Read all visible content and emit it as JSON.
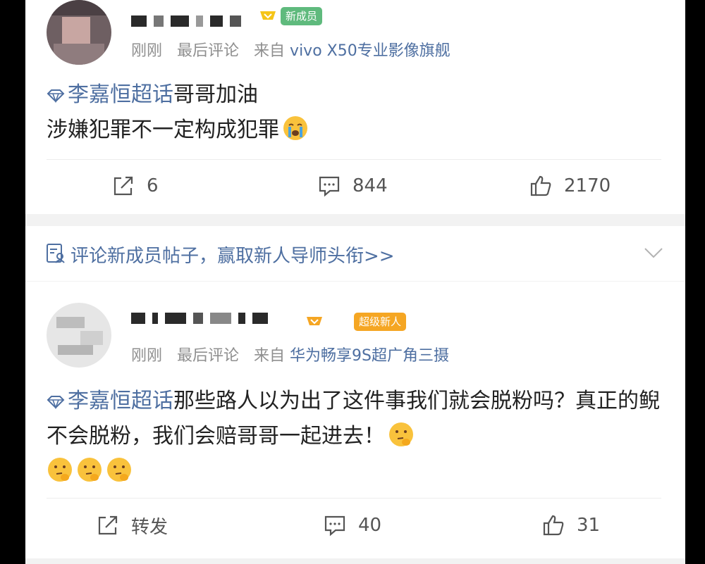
{
  "posts": [
    {
      "badge": "新成员",
      "meta": {
        "time": "刚刚",
        "activity": "最后评论",
        "from_prefix": "来自",
        "device": "vivo X50专业影像旗舰"
      },
      "content": {
        "topic": "李嘉恒超话",
        "line1_text": "哥哥加油",
        "line2_text": "涉嫌犯罪不一定构成犯罪"
      },
      "emojis": [
        "crying-face"
      ],
      "actions": {
        "repost": "6",
        "comments": "844",
        "likes": "2170"
      }
    },
    {
      "badge": "超级新人",
      "meta": {
        "time": "刚刚",
        "activity": "最后评论",
        "from_prefix": "来自",
        "device": "华为畅享9S超广角三摄"
      },
      "content": {
        "topic": "李嘉恒超话",
        "text": "那些路人以为出了这件事我们就会脱粉吗？真正的鲵不会脱粉，我们会赔哥哥一起进去！"
      },
      "emojis": [
        "thinking-face",
        "thinking-face",
        "thinking-face",
        "thinking-face"
      ],
      "actions": {
        "repost": "转发",
        "comments": "40",
        "likes": "31"
      }
    }
  ],
  "banner": {
    "text": "评论新成员帖子，赢取新人导师头衔>>"
  },
  "colors": {
    "link": "#4e6fa1",
    "badge_new": "#5fba7d",
    "badge_super": "#f5a623",
    "emoji": "#f9c23c"
  }
}
